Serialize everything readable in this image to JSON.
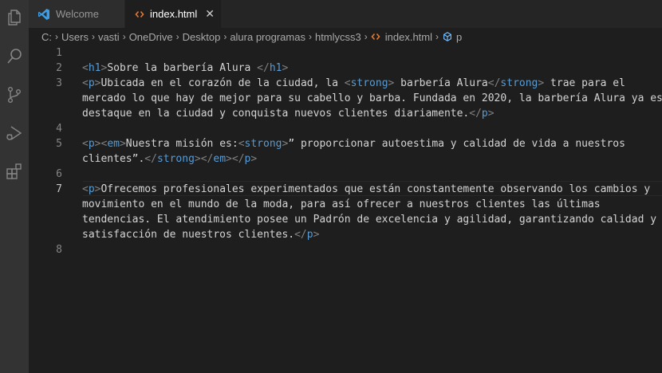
{
  "activity_bar": {
    "icons": [
      "files-icon",
      "search-icon",
      "source-control-icon",
      "run-debug-icon",
      "extensions-icon"
    ]
  },
  "tabs": [
    {
      "label": "Welcome",
      "icon": "vscode-logo-icon",
      "active": false
    },
    {
      "label": "index.html",
      "icon": "html-file-icon",
      "active": true,
      "close": "✕"
    }
  ],
  "breadcrumb": [
    "C:",
    "Users",
    "vasti",
    "OneDrive",
    "Desktop",
    "alura programas",
    "htmlycss3",
    "index.html",
    "p"
  ],
  "line_numbers": [
    "1",
    "2",
    "3",
    "4",
    "5",
    "6",
    "7",
    "8"
  ],
  "code": {
    "l2": {
      "t1": "<",
      "t2": "h1",
      "t3": ">",
      "t4": "Sobre la barbería Alura ",
      "t5": "</",
      "t6": "h1",
      "t7": ">"
    },
    "l3a": {
      "t1": "<",
      "t2": "p",
      "t3": ">",
      "t4": "Ubicada en el corazón de la ciudad, la ",
      "t5": "<",
      "t6": "strong",
      "t7": ">",
      "t8": " barbería Alura",
      "t9": "</",
      "t10": "strong",
      "t11": ">",
      "t12": " trae para el"
    },
    "l3b": "mercado lo que hay de mejor para su cabello y barba. Fundada en 2020, la barbería Alura ya es",
    "l3c": {
      "t1": "destaque en la ciudad y conquista nuevos clientes diariamente.",
      "t2": "</",
      "t3": "p",
      "t4": ">"
    },
    "l5a": {
      "t1": "<",
      "t2": "p",
      "t3": ">",
      "t4": "<",
      "t5": "em",
      "t6": ">",
      "t7": "Nuestra misión es:",
      "t8": "<",
      "t9": "strong",
      "t10": ">",
      "t11": "” proporcionar autoestima y calidad de vida a nuestros"
    },
    "l5b": {
      "t1": "clientes”.",
      "t2": "</",
      "t3": "strong",
      "t4": ">",
      "t5": "</",
      "t6": "em",
      "t7": ">",
      "t8": "</",
      "t9": "p",
      "t10": ">"
    },
    "l7a": {
      "t1": "<",
      "t2": "p",
      "t3": ">",
      "t4": "Ofrecemos profesionales experimentados que están constantemente observando los cambios y"
    },
    "l7b": "movimiento en el mundo de la moda, para así ofrecer a nuestros clientes las últimas",
    "l7c": "tendencias. El atendimiento posee un Padrón de excelencia y agilidad, garantizando calidad y",
    "l7d": {
      "t1": "satisfacción de nuestros clientes.",
      "t2": "</",
      "t3": "p",
      "t4": ">"
    }
  },
  "colors": {
    "tag": "#569cd6",
    "punct": "#808080",
    "text": "#d4d4d4",
    "html_icon": "#e37933",
    "vscode_blue": "#3c9ee5",
    "symbol_icon": "#75beff"
  }
}
